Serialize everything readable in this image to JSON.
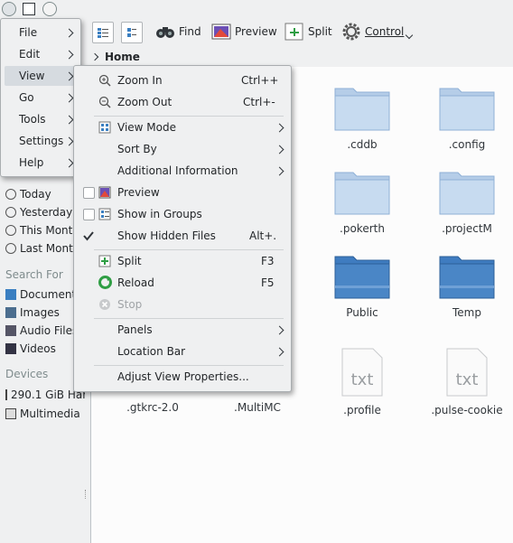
{
  "toolbar": {
    "find_label": "Find",
    "preview_label": "Preview",
    "split_label": "Split",
    "control_label": "Control"
  },
  "breadcrumb": {
    "location": "Home"
  },
  "main_menu": {
    "items": [
      {
        "label": "File"
      },
      {
        "label": "Edit"
      },
      {
        "label": "View"
      },
      {
        "label": "Go"
      },
      {
        "label": "Tools"
      },
      {
        "label": "Settings"
      },
      {
        "label": "Help"
      }
    ]
  },
  "view_menu": {
    "zoom_in": {
      "label": "Zoom In",
      "shortcut": "Ctrl++"
    },
    "zoom_out": {
      "label": "Zoom Out",
      "shortcut": "Ctrl+-"
    },
    "view_mode": {
      "label": "View Mode"
    },
    "sort_by": {
      "label": "Sort By"
    },
    "additional_info": {
      "label": "Additional Information"
    },
    "preview": {
      "label": "Preview"
    },
    "show_in_groups": {
      "label": "Show in Groups"
    },
    "show_hidden": {
      "label": "Show Hidden Files",
      "shortcut": "Alt+."
    },
    "split": {
      "label": "Split",
      "shortcut": "F3"
    },
    "reload": {
      "label": "Reload",
      "shortcut": "F5"
    },
    "stop": {
      "label": "Stop"
    },
    "panels": {
      "label": "Panels"
    },
    "location_bar": {
      "label": "Location Bar"
    },
    "adjust_view": {
      "label": "Adjust View Properties..."
    }
  },
  "sidebar": {
    "recent_items": [
      "Today",
      "Yesterday",
      "This Month",
      "Last Month"
    ],
    "search_for_header": "Search For",
    "search_items": [
      "Documents",
      "Images",
      "Audio Files",
      "Videos"
    ],
    "devices_header": "Devices",
    "device_items": [
      "290.1 GiB Hard Drive",
      "Multimedia"
    ]
  },
  "files": [
    {
      "name": ".cddb",
      "type": "folder"
    },
    {
      "name": ".config",
      "type": "folder"
    },
    {
      "name": ".pokerth",
      "type": "folder"
    },
    {
      "name": ".projectM",
      "type": "folder"
    },
    {
      "name": "Public",
      "type": "folder-dark"
    },
    {
      "name": "Temp",
      "type": "folder-dark"
    },
    {
      "name": ".gtkrc-2.0",
      "type": "text"
    },
    {
      "name": ".MultiMC",
      "type": "text"
    },
    {
      "name": ".profile",
      "type": "text"
    },
    {
      "name": ".pulse-cookie",
      "type": "text"
    }
  ],
  "colors": {
    "folder_light": "#b5cde8",
    "folder_dark": "#4a86c6",
    "menu_bg": "#eff0f1",
    "selection": "#d6dbe0"
  }
}
